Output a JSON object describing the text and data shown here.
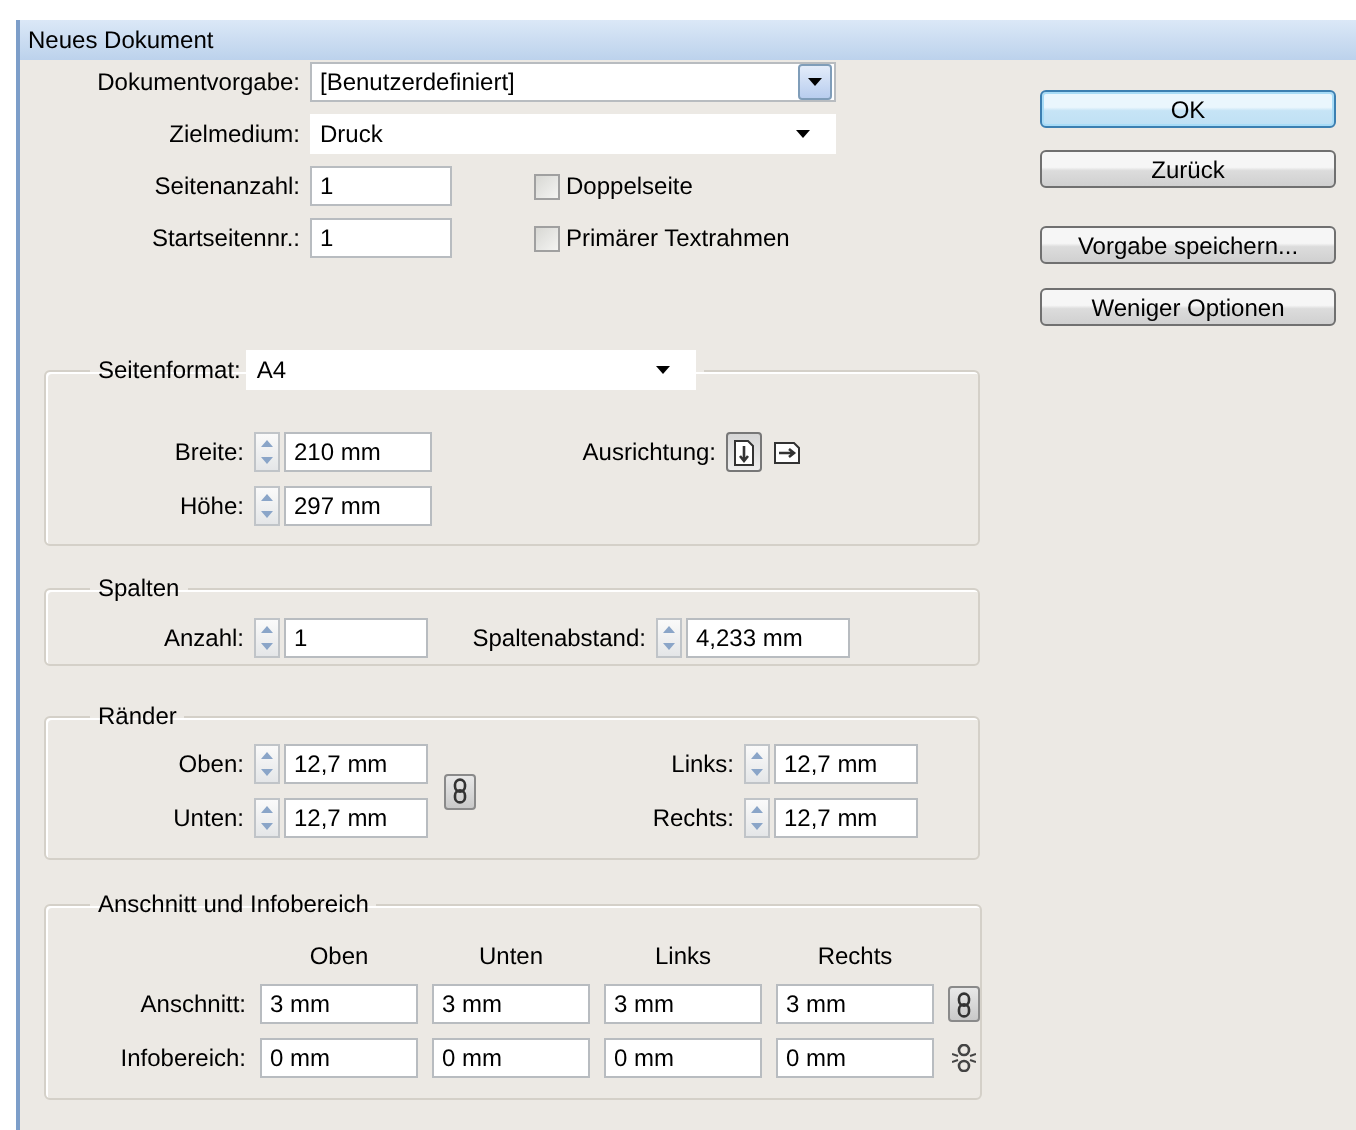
{
  "window": {
    "title": "Neues Dokument"
  },
  "document": [
    {
      "kind": "combo",
      "label": "Dokumentvorgabe:",
      "value": "[Benutzerdefiniert]"
    },
    {
      "kind": "list",
      "label": "Zielmedium:",
      "value": "Druck"
    }
  ],
  "pages": [
    {
      "label": "Seitenanzahl:",
      "value": "1"
    },
    {
      "label": "Startseitennr.:",
      "value": "1"
    }
  ],
  "options": [
    {
      "label": "Doppelseite",
      "checked": false
    },
    {
      "label": "Primärer Textrahmen",
      "checked": false
    }
  ],
  "page_format": {
    "label": "Seitenformat:",
    "value": "A4",
    "size": [
      {
        "label": "Breite:",
        "value": "210 mm"
      },
      {
        "label": "Höhe:",
        "value": "297 mm"
      }
    ],
    "orientation_label": "Ausrichtung:",
    "orientation": [
      {
        "kind": "portrait",
        "selected": true
      },
      {
        "kind": "landscape",
        "selected": false
      }
    ]
  },
  "columns": {
    "title": "Spalten",
    "count": {
      "label": "Anzahl:",
      "value": "1"
    },
    "gutter": {
      "label": "Spaltenabstand:",
      "value": "4,233 mm"
    }
  },
  "margins": {
    "title": "Ränder",
    "fields": [
      {
        "label": "Oben:",
        "value": "12,7 mm"
      },
      {
        "label": "Links:",
        "value": "12,7 mm"
      },
      {
        "label": "Unten:",
        "value": "12,7 mm"
      },
      {
        "label": "Rechts:",
        "value": "12,7 mm"
      }
    ],
    "linked": true
  },
  "bleed": {
    "title": "Anschnitt und Infobereich",
    "headers": [
      "Oben",
      "Unten",
      "Links",
      "Rechts"
    ],
    "rows": [
      {
        "label": "Anschnitt:",
        "values": [
          "3 mm",
          "3 mm",
          "3 mm",
          "3 mm"
        ],
        "linked": true
      },
      {
        "label": "Infobereich:",
        "values": [
          "0 mm",
          "0 mm",
          "0 mm",
          "0 mm"
        ],
        "linked": false
      }
    ]
  },
  "buttons": [
    {
      "label": "OK",
      "default": true
    },
    {
      "label": "Zurück",
      "default": false
    },
    {
      "label": "Vorgabe speichern...",
      "default": false
    },
    {
      "label": "Weniger Optionen",
      "default": false
    }
  ]
}
